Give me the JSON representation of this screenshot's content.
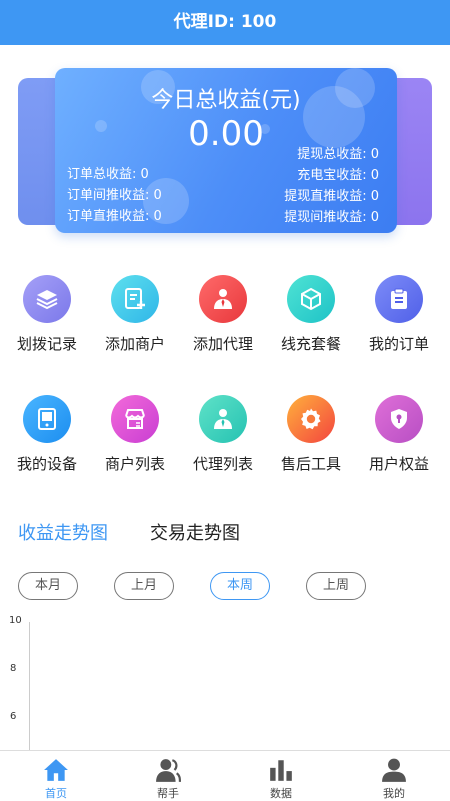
{
  "header": {
    "title": "代理ID: 100"
  },
  "earnings_card": {
    "title": "今日总收益(元)",
    "amount": "0.00",
    "left_stats": [
      "订单总收益: 0",
      "订单间推收益: 0",
      "订单直推收益: 0"
    ],
    "right_stats": [
      "提现总收益: 0",
      "充电宝收益: 0",
      "提现直推收益: 0",
      "提现间推收益: 0"
    ]
  },
  "menu": {
    "row1": [
      {
        "label": "划拨记录",
        "icon": "layers-icon"
      },
      {
        "label": "添加商户",
        "icon": "add-document-icon"
      },
      {
        "label": "添加代理",
        "icon": "agent-icon"
      },
      {
        "label": "线充套餐",
        "icon": "package-box-icon"
      },
      {
        "label": "我的订单",
        "icon": "clipboard-icon"
      }
    ],
    "row2": [
      {
        "label": "我的设备",
        "icon": "device-icon"
      },
      {
        "label": "商户列表",
        "icon": "shop-icon"
      },
      {
        "label": "代理列表",
        "icon": "agent-list-icon"
      },
      {
        "label": "售后工具",
        "icon": "gear-icon"
      },
      {
        "label": "用户权益",
        "icon": "shield-icon"
      }
    ]
  },
  "trend_tabs": {
    "active": "收益走势图",
    "inactive": "交易走势图"
  },
  "period_filters": [
    "本月",
    "上月",
    "本周",
    "上周"
  ],
  "period_selected": "本周",
  "chart_data": {
    "type": "line",
    "ylim": [
      6,
      10
    ],
    "yticks": [
      "10",
      "8",
      "6"
    ],
    "series": []
  },
  "bottom_nav": [
    {
      "label": "首页",
      "icon": "home-icon",
      "active": true
    },
    {
      "label": "帮手",
      "icon": "helper-icon",
      "active": false
    },
    {
      "label": "数据",
      "icon": "bar-chart-icon",
      "active": false
    },
    {
      "label": "我的",
      "icon": "user-icon",
      "active": false
    }
  ],
  "colors": {
    "primary": "#3e97f3"
  }
}
